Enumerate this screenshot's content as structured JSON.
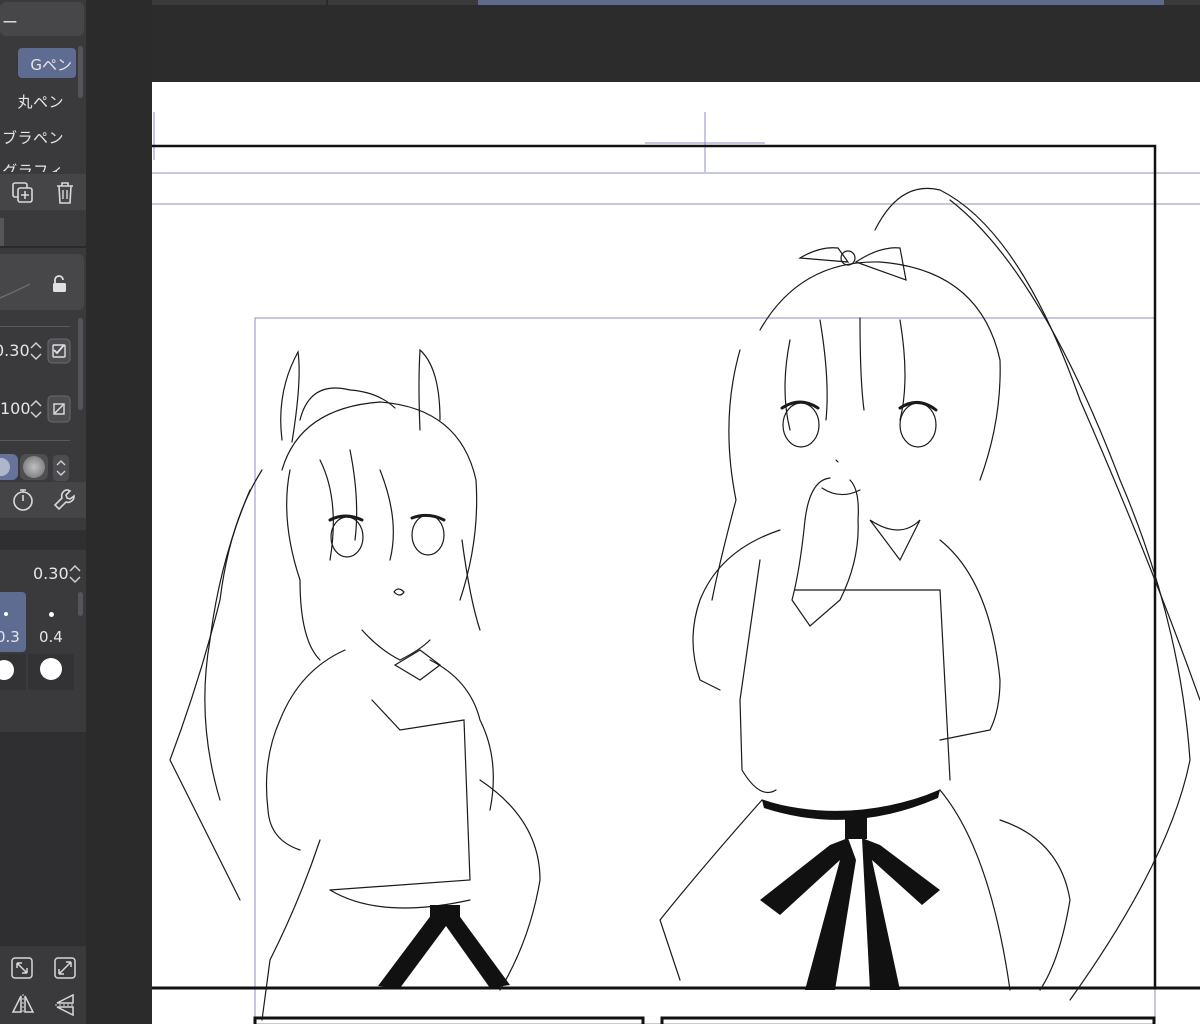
{
  "panel": {
    "header_label": "ー",
    "brushes": [
      {
        "label": "Gペン",
        "selected": true
      },
      {
        "label": "丸ペン",
        "selected": false
      },
      {
        "label": "カブラペン",
        "selected": false
      },
      {
        "label": "リグラフィ",
        "selected": false
      }
    ],
    "property_values": {
      "brush_size_value": "0.30",
      "opacity_value": "100"
    },
    "size_slider_value": "0.30",
    "size_presets": [
      {
        "label": "0.3",
        "selected": true
      },
      {
        "label": "0.4",
        "selected": false
      }
    ],
    "icons": [
      "duplicate-icon",
      "trash-icon",
      "lock-icon",
      "check-icon",
      "no-entry-icon",
      "stopwatch-icon",
      "wrench-icon",
      "resize-icon",
      "fit-icon",
      "flip-horizontal-icon",
      "flip-vertical-icon"
    ]
  },
  "colors": {
    "panel_bg": "#3a3a3c",
    "selection": "#5f6c91",
    "canvas_bg": "#ffffff",
    "guide": "#7d7fb3"
  }
}
